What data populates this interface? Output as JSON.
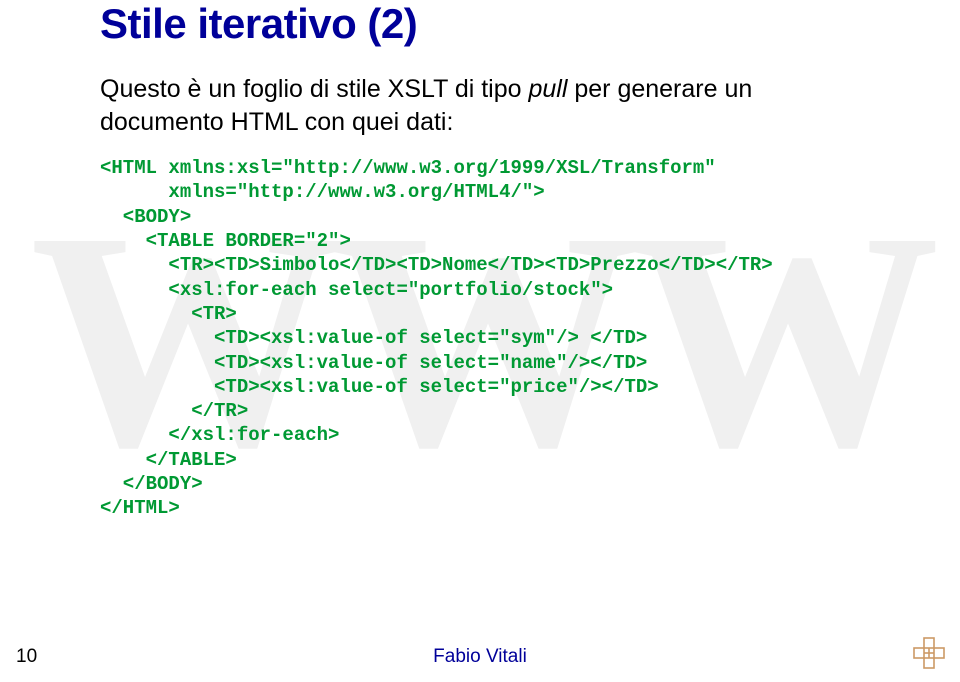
{
  "title": "Stile iterativo (2)",
  "watermark": "WWW",
  "intro_line1": "Questo è un foglio di stile XSLT di tipo ",
  "intro_pull": "pull",
  "intro_line1b": " per generare un",
  "intro_line2": "documento HTML con quei dati:",
  "code": "<HTML xmlns:xsl=\"http://www.w3.org/1999/XSL/Transform\"\n      xmlns=\"http://www.w3.org/HTML4/\">\n  <BODY>\n    <TABLE BORDER=\"2\">\n      <TR><TD>Simbolo</TD><TD>Nome</TD><TD>Prezzo</TD></TR>\n      <xsl:for-each select=\"portfolio/stock\">\n        <TR>\n          <TD><xsl:value-of select=\"sym\"/> </TD>\n          <TD><xsl:value-of select=\"name\"/></TD>\n          <TD><xsl:value-of select=\"price\"/></TD>\n        </TR>\n      </xsl:for-each>\n    </TABLE>\n  </BODY>\n</HTML>",
  "page_number": "10",
  "author": "Fabio Vitali"
}
